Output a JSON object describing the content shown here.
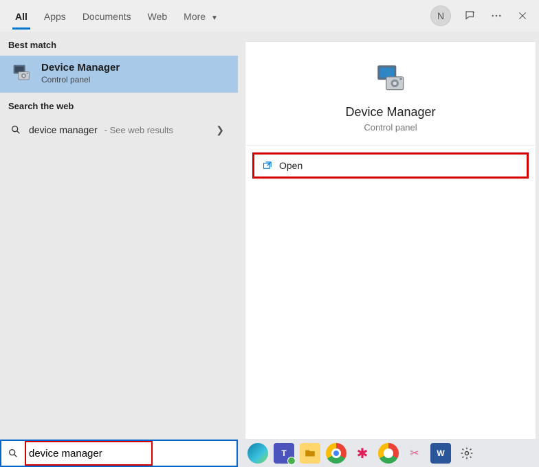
{
  "tabs": {
    "all": "All",
    "apps": "Apps",
    "documents": "Documents",
    "web": "Web",
    "more": "More"
  },
  "avatar_letter": "N",
  "left": {
    "best_match_header": "Best match",
    "best_match": {
      "title": "Device Manager",
      "subtitle": "Control panel"
    },
    "search_web_header": "Search the web",
    "web_result": {
      "query": "device manager",
      "suffix": " - See web results"
    }
  },
  "right": {
    "title": "Device Manager",
    "subtitle": "Control panel",
    "open": "Open"
  },
  "search": {
    "value": "device manager"
  }
}
